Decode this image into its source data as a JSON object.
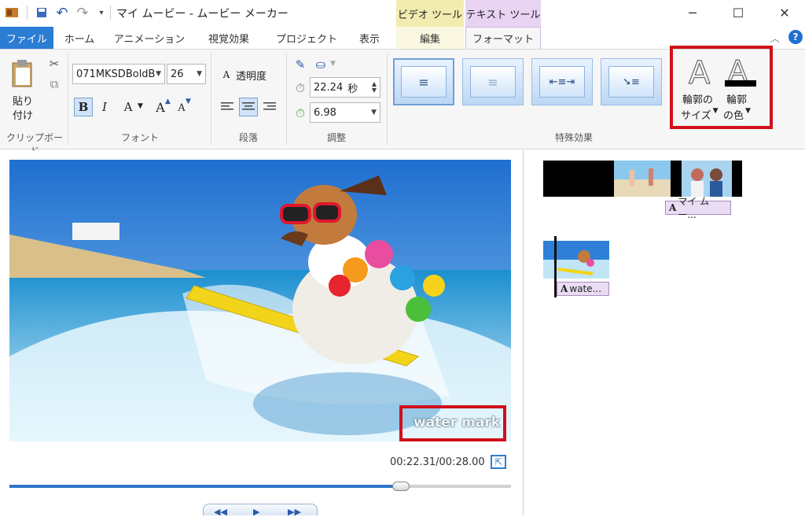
{
  "titlebar": {
    "title": "マイ ムービー - ムービー メーカー",
    "context_tabs": [
      "ビデオ ツール",
      "テキスト ツール"
    ],
    "colors": {
      "video_tools": "#f3ecb0",
      "text_tools": "#e8d3f2"
    }
  },
  "tabs": [
    {
      "label": "ファイル"
    },
    {
      "label": "ホーム"
    },
    {
      "label": "アニメーション"
    },
    {
      "label": "視覚効果"
    },
    {
      "label": "プロジェクト"
    },
    {
      "label": "表示"
    },
    {
      "label": "編集"
    },
    {
      "label": "フォーマット"
    }
  ],
  "ribbon": {
    "clipboard": {
      "paste_line1": "貼り",
      "paste_line2": "付け",
      "group": "クリップボード"
    },
    "font": {
      "family": "071MKSDBoldB",
      "size": "26",
      "bold": "B",
      "italic": "I",
      "color_a": "A",
      "grow": "A",
      "shrink": "A",
      "group": "フォント"
    },
    "paragraph": {
      "transparency": "透明度",
      "group": "段落"
    },
    "adjust": {
      "start_time": "22.24",
      "start_unit": "秒",
      "duration": "6.98",
      "group": "調整"
    },
    "effects": {
      "group": "特殊効果"
    },
    "outline": {
      "size_line1": "輪郭の",
      "size_line2": "サイズ",
      "color_line1": "輪郭",
      "color_line2": "の色"
    }
  },
  "preview": {
    "watermark": "water mark",
    "timecode": "00:22.31/00:28.00",
    "seek_fraction": 0.78
  },
  "storyboard": {
    "caption1": "マイ ムー...",
    "caption2": "wate..."
  },
  "colors": {
    "accent": "#2b7cd3",
    "highlight_red": "#d0101a",
    "caption_chip": "#eadcf3"
  }
}
